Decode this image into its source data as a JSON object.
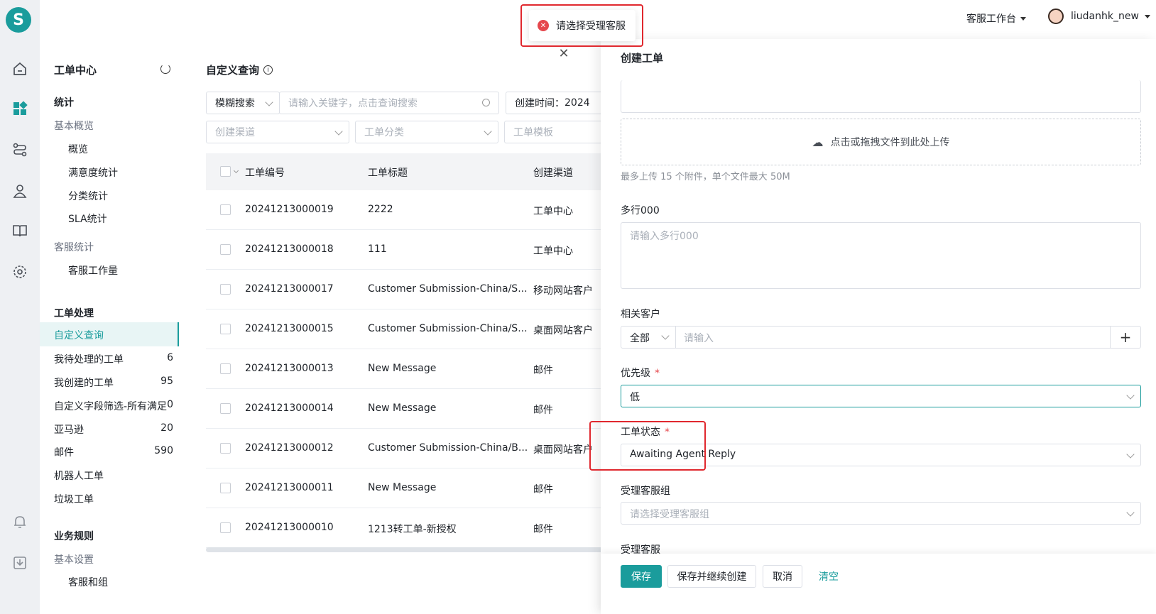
{
  "app": {
    "logo": "S"
  },
  "rail": {
    "icons": [
      "home-icon",
      "dashboard-icon",
      "route-icon",
      "user-icon",
      "book-icon",
      "settings-icon",
      "bell-icon",
      "download-icon"
    ]
  },
  "topbar": {
    "workspace": "客服工作台",
    "username": "liudanhk_new"
  },
  "toast": {
    "message": "请选择受理客服"
  },
  "nav": {
    "title": "工单中心",
    "sections": {
      "stats": "统计",
      "basic_overview": "基本概览",
      "overview": "概览",
      "satisfaction": "满意度统计",
      "category": "分类统计",
      "sla": "SLA统计",
      "agent_stats": "客服统计",
      "agent_workload": "客服工作量",
      "processing": "工单处理",
      "custom_query": "自定义查询",
      "my_pending": "我待处理的工单",
      "my_pending_count": "6",
      "my_created": "我创建的工单",
      "my_created_count": "95",
      "custom_field": "自定义字段筛选-所有满足",
      "custom_field_count": "0",
      "amazon": "亚马逊",
      "amazon_count": "20",
      "mail": "邮件",
      "mail_count": "590",
      "robot": "机器人工单",
      "trash": "垃圾工单",
      "rules": "业务规则",
      "basic_settings": "基本设置",
      "agents_groups": "客服和组"
    }
  },
  "main": {
    "title": "自定义查询",
    "search_mode": "模糊搜索",
    "search_placeholder": "请输入关键字，点击查询搜索",
    "created_time_label": "创建时间：",
    "created_time_value": "2024",
    "filter_channel": "创建渠道",
    "filter_category": "工单分类",
    "filter_template": "工单模板",
    "columns": {
      "id": "工单编号",
      "title": "工单标题",
      "channel": "创建渠道"
    },
    "rows": [
      {
        "id": "20241213000019",
        "title": "2222",
        "channel": "工单中心"
      },
      {
        "id": "20241213000018",
        "title": "111",
        "channel": "工单中心"
      },
      {
        "id": "20241213000017",
        "title": "Customer Submission-China/S...",
        "channel": "移动网站客户"
      },
      {
        "id": "20241213000015",
        "title": "Customer Submission-China/S...",
        "channel": "桌面网站客户"
      },
      {
        "id": "20241213000013",
        "title": "New Message",
        "channel": "邮件"
      },
      {
        "id": "20241213000014",
        "title": "New Message",
        "channel": "邮件"
      },
      {
        "id": "20241213000012",
        "title": "Customer Submission-China/B...",
        "channel": "桌面网站客户"
      },
      {
        "id": "20241213000011",
        "title": "New Message",
        "channel": "邮件"
      },
      {
        "id": "20241213000010",
        "title": "1213转工单-新授权",
        "channel": "邮件"
      }
    ]
  },
  "drawer": {
    "title": "创建工单",
    "upload_text": "点击或拖拽文件到此处上传",
    "upload_hint": "最多上传 15 个附件，单个文件最大 50M",
    "multiline_label": "多行000",
    "multiline_placeholder": "请输入多行000",
    "customer_label": "相关客户",
    "customer_scope": "全部",
    "customer_placeholder": "请输入",
    "priority_label": "优先级",
    "priority_value": "低",
    "status_label": "工单状态",
    "status_value": "Awaiting Agent Reply",
    "group_label": "受理客服组",
    "group_placeholder": "请选择受理客服组",
    "agent_label": "受理客服",
    "required_mark": "*",
    "buttons": {
      "save": "保存",
      "save_continue": "保存并继续创建",
      "cancel": "取消",
      "clear": "清空"
    }
  },
  "colors": {
    "accent": "#1a9c9c",
    "danger": "#e0282e"
  }
}
